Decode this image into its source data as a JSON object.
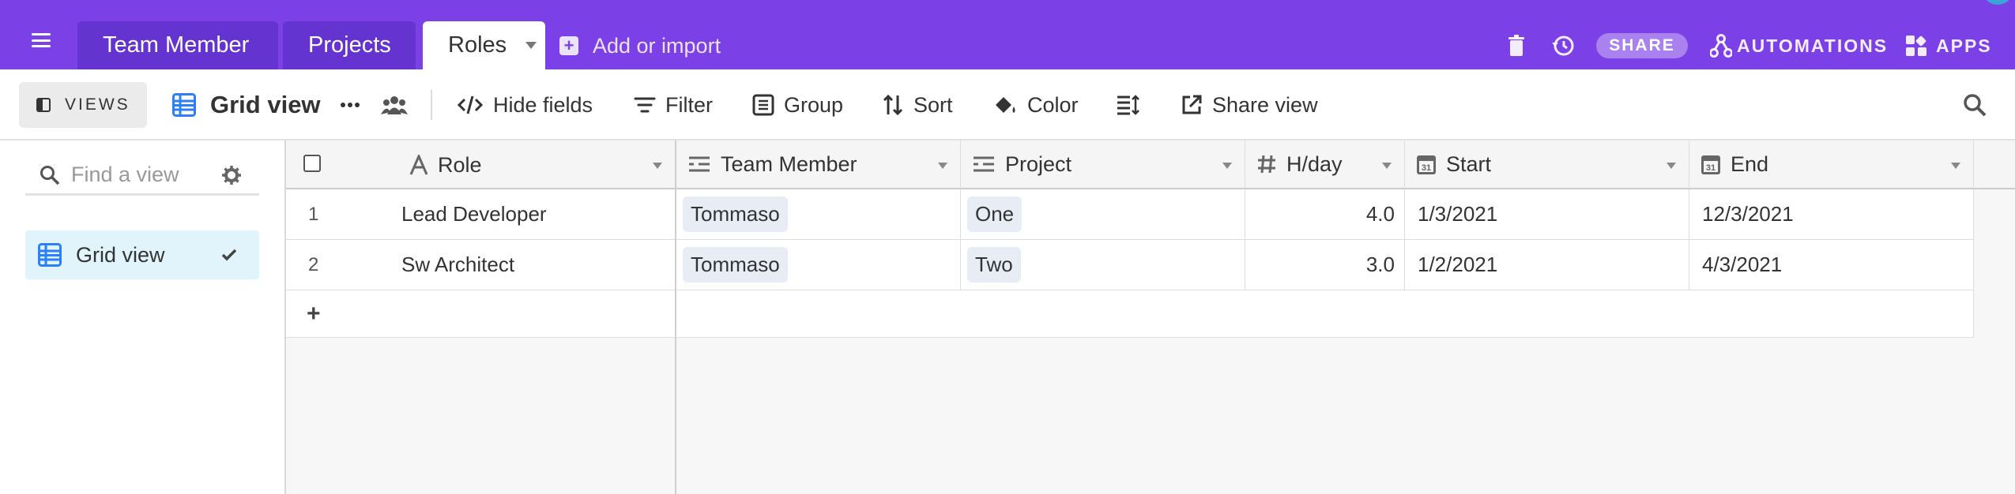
{
  "tabs": [
    {
      "label": "Team Member"
    },
    {
      "label": "Projects"
    },
    {
      "label": "Roles"
    }
  ],
  "add_or_import": "Add or import",
  "top_actions": {
    "share": "SHARE",
    "automations": "AUTOMATIONS",
    "apps": "APPS"
  },
  "toolbar": {
    "views": "VIEWS",
    "view_name": "Grid view",
    "hide_fields": "Hide fields",
    "filter": "Filter",
    "group": "Group",
    "sort": "Sort",
    "color": "Color",
    "share_view": "Share view"
  },
  "sidebar": {
    "find_placeholder": "Find a view",
    "views": [
      {
        "label": "Grid view"
      }
    ]
  },
  "table": {
    "columns": [
      {
        "label": "Role"
      },
      {
        "label": "Team Member"
      },
      {
        "label": "Project"
      },
      {
        "label": "H/day"
      },
      {
        "label": "Start"
      },
      {
        "label": "End"
      }
    ],
    "rows": [
      {
        "num": "1",
        "role": "Lead Developer",
        "team_member": "Tommaso",
        "project": "One",
        "hday": "4.0",
        "start": "1/3/2021",
        "end": "12/3/2021"
      },
      {
        "num": "2",
        "role": "Sw Architect",
        "team_member": "Tommaso",
        "project": "Two",
        "hday": "3.0",
        "start": "1/2/2021",
        "end": "4/3/2021"
      }
    ],
    "add_row": "+"
  },
  "colors": {
    "brand": "#7b40e6",
    "tab_inactive": "#6433d0",
    "selected_view": "#e1f3fb",
    "grid_icon": "#2d7ff9"
  }
}
